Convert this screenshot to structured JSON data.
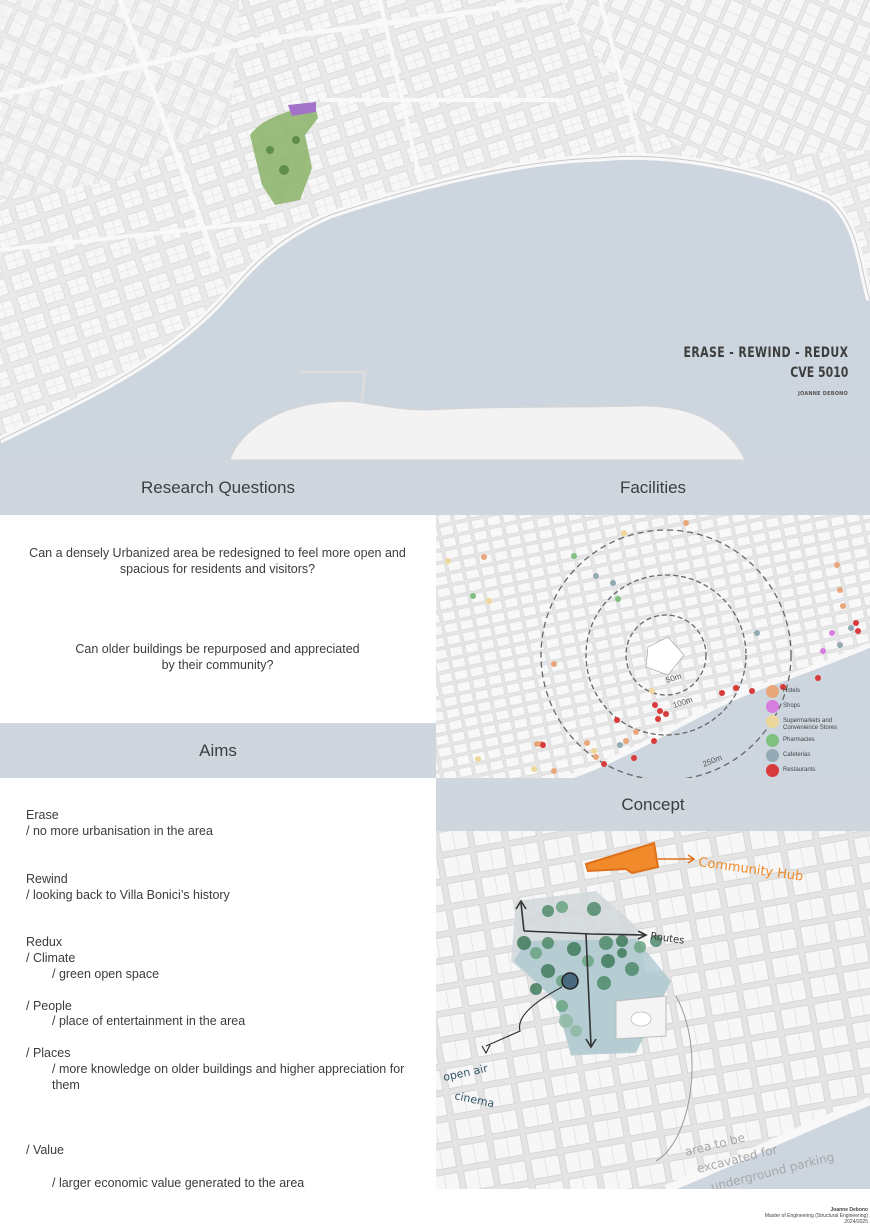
{
  "poster": {
    "title": "ERASE - REWIND - REDUX",
    "code": "CVE 5010",
    "author": "JOANNE DEBONO"
  },
  "sections": {
    "research_questions": "Research Questions",
    "facilities": "Facilities",
    "aims": "Aims",
    "concept": "Concept"
  },
  "research_questions": [
    "Can a densely Urbanized area be redesigned to feel more open and spacious for residents and visitors?",
    "Can older buildings be repurposed and appreciated by their community?"
  ],
  "aims": {
    "erase_title": "Erase",
    "erase_text": "/ no more urbanisation in the area",
    "rewind_title": "Rewind",
    "rewind_text": "/ looking back to Villa Bonici’s history",
    "redux_title": "Redux",
    "climate": "/ Climate",
    "climate_text": "/ green open space",
    "people": "/ People",
    "people_text": "/ place of entertainment in the area",
    "places": "/ Places",
    "places_text": "/ more knowledge on older buildings and higher appreciation for them",
    "value": "/ Value",
    "value_text": "/ larger economic value generated to the area"
  },
  "facilities_map": {
    "rings": [
      "50m",
      "100m",
      "250m"
    ],
    "legend": [
      {
        "label": "Hotels",
        "color": "#e8a77a"
      },
      {
        "label": "Shops",
        "color": "#d77de0"
      },
      {
        "label": "Supermarkets and Convenience Stores",
        "color": "#eed79a"
      },
      {
        "label": "Pharmacies",
        "color": "#7fbf7f"
      },
      {
        "label": "Cafeterias",
        "color": "#93aab4"
      },
      {
        "label": "Restaurants",
        "color": "#d83b3b"
      }
    ]
  },
  "concept_map": {
    "community_hub": "Community Hub",
    "routes": "Routes",
    "open_air_cinema_1": "open air",
    "open_air_cinema_2": "cinema",
    "excavation_1": "area to be",
    "excavation_2": "excavated for",
    "excavation_3": "underground parking",
    "accent_color": "#f08a2a"
  },
  "footer": {
    "name": "Joanne Debono",
    "degree": "Master of Engineering (Structural Engineering)",
    "year": "2024/2025"
  }
}
